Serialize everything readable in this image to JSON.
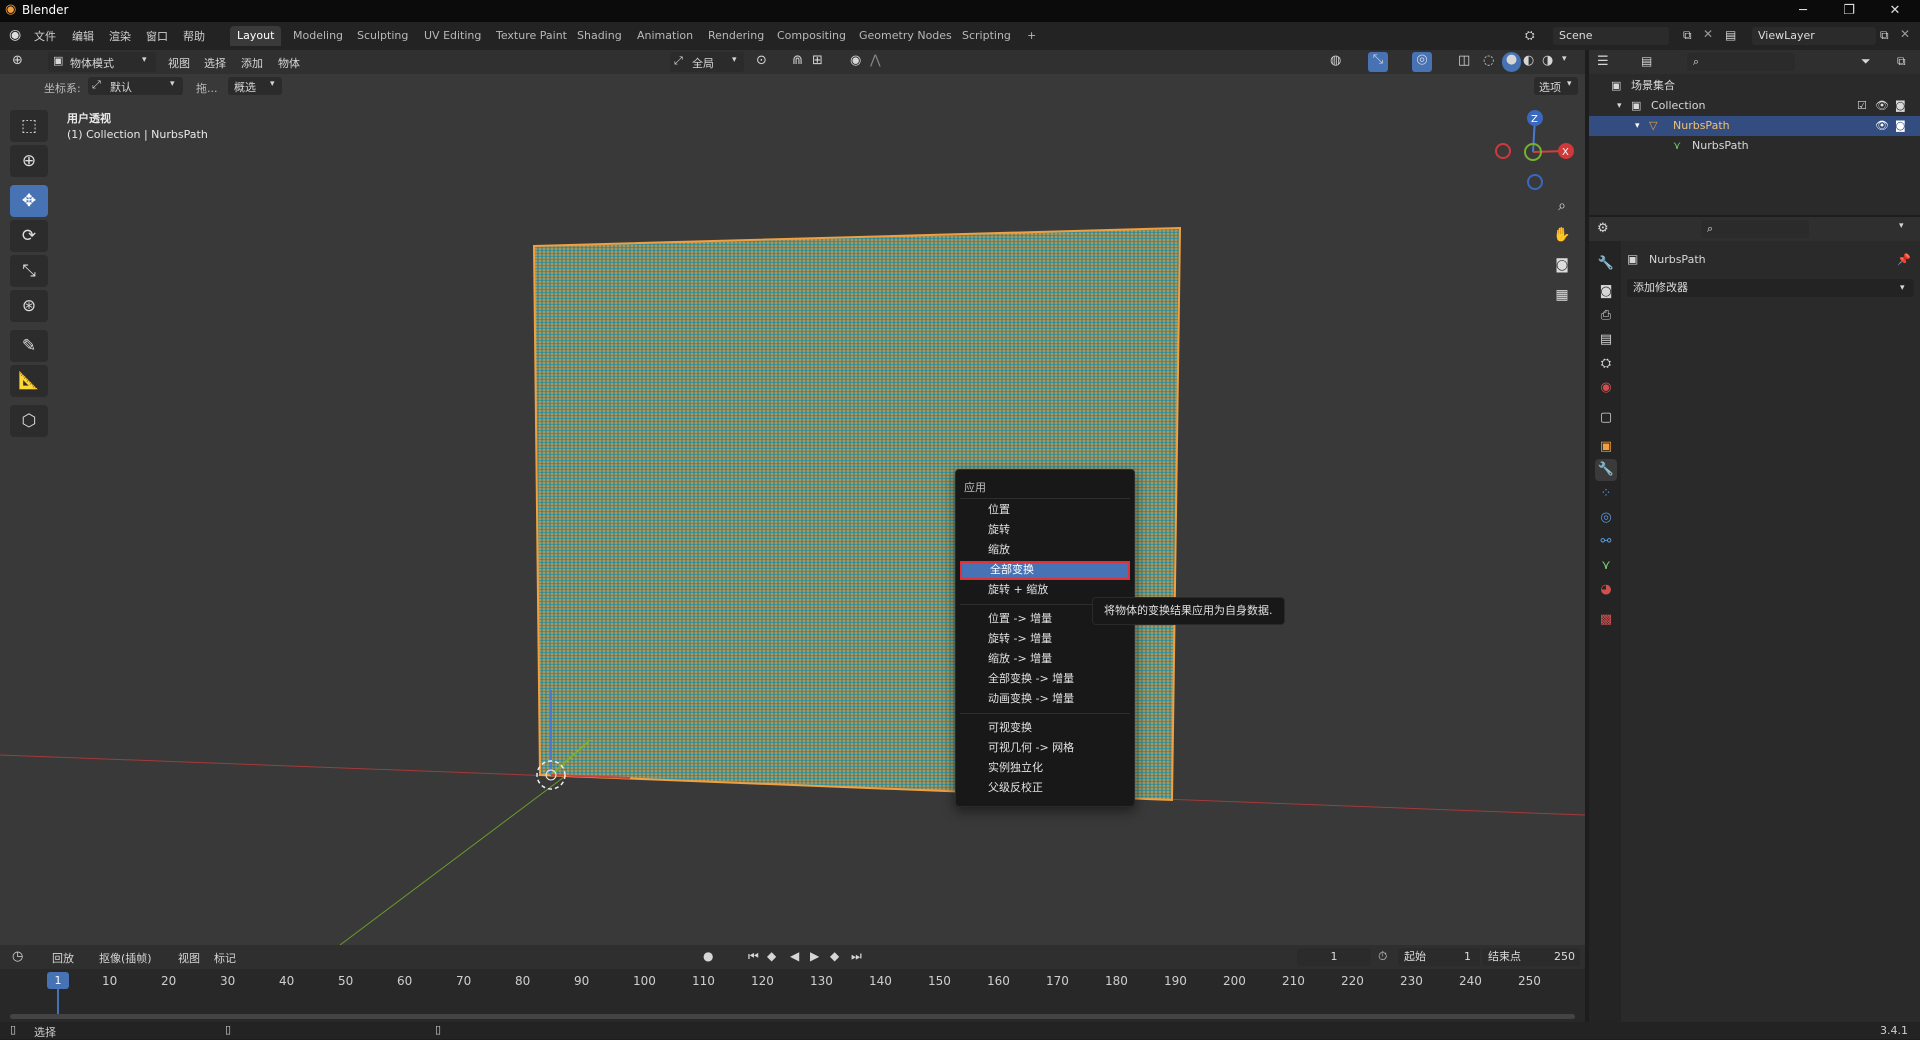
{
  "window": {
    "title": "Blender",
    "minimize": "─",
    "restore": "❐",
    "close": "✕"
  },
  "menu": {
    "file": "文件",
    "edit": "编辑",
    "render": "渲染",
    "window": "窗口",
    "help": "帮助"
  },
  "workspaces": [
    "Layout",
    "Modeling",
    "Sculpting",
    "UV Editing",
    "Texture Paint",
    "Shading",
    "Animation",
    "Rendering",
    "Compositing",
    "Geometry Nodes",
    "Scripting"
  ],
  "workspace_add": "+",
  "scene": {
    "name": "Scene",
    "view_layer": "ViewLayer"
  },
  "header3d": {
    "mode": "物体模式",
    "view": "视图",
    "select": "选择",
    "add": "添加",
    "object": "物体",
    "global": "全局",
    "options": "选项"
  },
  "tool_settings": {
    "orientation_label": "坐标系:",
    "orientation_value": "默认",
    "drag_label": "拖...",
    "drag_value": "概选"
  },
  "viewport": {
    "view_name": "用户透视",
    "collection_info": "(1) Collection | NurbsPath"
  },
  "gizmo": {
    "z": "Z",
    "x": "X"
  },
  "context_menu": {
    "title": "应用",
    "group1": [
      "位置",
      "旋转",
      "缩放",
      "全部变换",
      "旋转 + 缩放"
    ],
    "group2": [
      "位置 -> 增量",
      "旋转 -> 增量",
      "缩放 -> 增量",
      "全部变换 -> 增量",
      "动画变换 -> 增量"
    ],
    "group3": [
      "可视变换",
      "可视几何 -> 网格",
      "实例独立化",
      "父级反校正"
    ],
    "highlighted": "全部变换"
  },
  "tooltip": "将物体的变换结果应用为自身数据.",
  "timeline": {
    "playback": "回放",
    "keying": "抠像(插帧)",
    "view": "视图",
    "marker": "标记",
    "current_frame": "1",
    "start_label": "起始",
    "start": "1",
    "end_label": "结束点",
    "end": "250",
    "ticks": [
      "10",
      "20",
      "30",
      "40",
      "50",
      "60",
      "70",
      "80",
      "90",
      "100",
      "110",
      "120",
      "130",
      "140",
      "150",
      "160",
      "170",
      "180",
      "190",
      "200",
      "210",
      "220",
      "230",
      "240",
      "250"
    ],
    "current_marker": "1"
  },
  "statusbar": {
    "select": "选择",
    "version": "3.4.1"
  },
  "outliner": {
    "scene_collection": "场景集合",
    "collection": "Collection",
    "object": "NurbsPath",
    "data": "NurbsPath"
  },
  "properties": {
    "object_name": "NurbsPath",
    "add_modifier": "添加修改器"
  },
  "colors": {
    "accent": "#4772b3",
    "highlight_border": "#e0303a",
    "wire": "#e8963a",
    "mesh": "#3aa0a0"
  }
}
